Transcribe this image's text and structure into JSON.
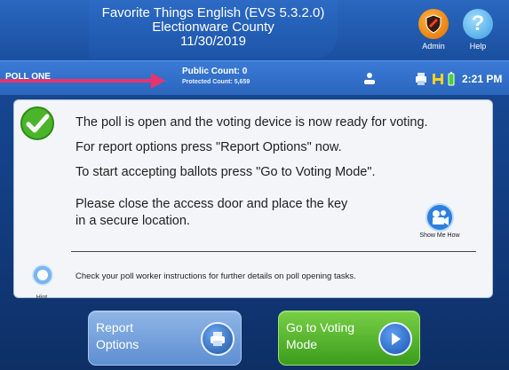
{
  "header": {
    "title_line1": "Favorite Things English (EVS 5.3.2.0)",
    "title_line2": "Electionware County",
    "title_line3": "11/30/2019",
    "admin_label": "Admin",
    "help_label": "Help",
    "help_glyph": "?"
  },
  "status_bar": {
    "poll_label": "POLL ONE",
    "public_count": "Public Count: 0",
    "protected_count": "Protected Count: 5,659",
    "time": "2:21 PM",
    "icons": [
      "user-icon",
      "printer-icon",
      "usb-drive-icon",
      "battery-icon"
    ]
  },
  "annotation": {
    "arrow_color": "#e8336f"
  },
  "main": {
    "line1": "The poll is open and the voting device is now ready for voting.",
    "line2": "For report options press \"Report Options\" now.",
    "line3": "To start accepting ballots press \"Go to Voting Mode\".",
    "line4": "Please close the access door and place the key",
    "line5": "in a secure location.",
    "show_me_how": "Show Me How",
    "hint_label": "Hint",
    "hint_text": "Check your poll worker instructions for further details on poll opening tasks."
  },
  "buttons": {
    "report_line1": "Report",
    "report_line2": "Options",
    "voting_line1": "Go to Voting",
    "voting_line2": "Mode"
  },
  "colors": {
    "accent_green": "#4bb52a",
    "accent_blue": "#2c66bd",
    "admin_orange": "#e06d00"
  }
}
